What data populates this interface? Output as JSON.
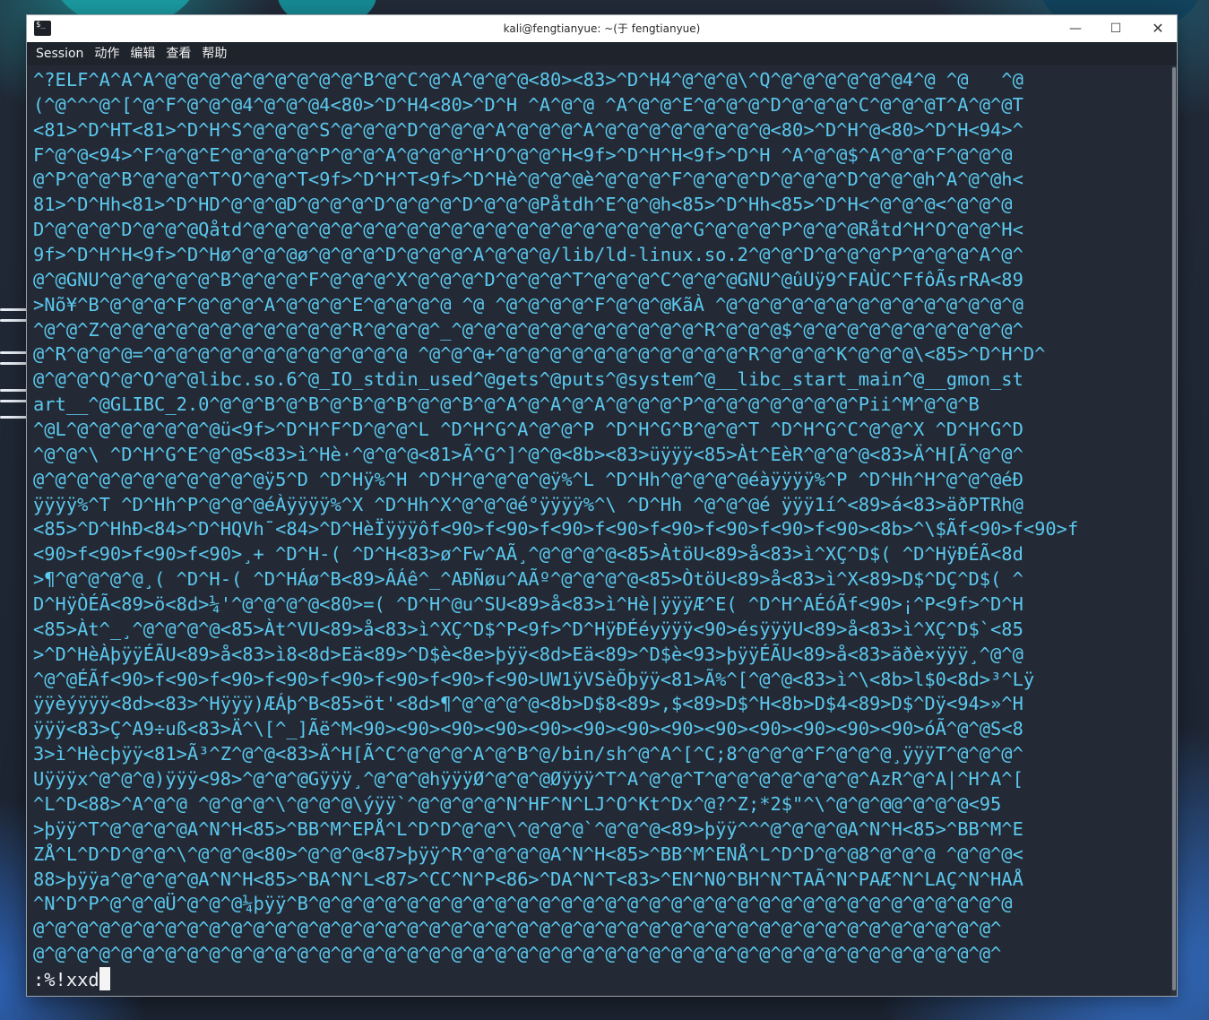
{
  "window": {
    "title": "kali@fengtianyue: ~(于 fengtianyue)",
    "app_icon_glyph": "$_",
    "controls": {
      "minimize": "—",
      "maximize": "☐",
      "close": "✕"
    }
  },
  "menu": [
    "Session",
    "动作",
    "编辑",
    "查看",
    "帮助"
  ],
  "terminal": {
    "lines": [
      "^?ELF^A^A^A^@^@^@^@^@^@^@^@^@^B^@^C^@^A^@^@^@<80><83>^D^H4^@^@^@\\^Q^@^@^@^@^@^@4^@ ^@   ^@",
      "(^@^^^@^[^@^F^@^@^@4^@^@^@4<80>^D^H4<80>^D^H ^A^@^@ ^A^@^@^E^@^@^@^D^@^@^@^C^@^@^@T^A^@^@T",
      "<81>^D^HT<81>^D^H^S^@^@^@^S^@^@^@^D^@^@^@^A^@^@^@^A^@^@^@^@^@^@^@^@<80>^D^H^@<80>^D^H<94>^",
      "F^@^@<94>^F^@^@^E^@^@^@^@^P^@^@^A^@^@^@^H^O^@^@^H<9f>^D^H^H<9f>^D^H ^A^@^@$^A^@^@^F^@^@^@",
      "@^P^@^@^B^@^@^@^T^O^@^@^T<9f>^D^H^T<9f>^D^Hè^@^@^@è^@^@^@^F^@^@^@^D^@^@^@^D^@^@^@h^A^@^@h<",
      "81>^D^Hh<81>^D^HD^@^@^@D^@^@^@^D^@^@^@^D^@^@^@Påtdh^E^@^@h<85>^D^Hh<85>^D^H<^@^@^@<^@^@^@",
      "D^@^@^@^D^@^@^@Qåtd^@^@^@^@^@^@^@^@^@^@^@^@^@^@^@^@^@^@^@^@^G^@^@^@^P^@^@^@Råtd^H^O^@^@^H<",
      "9f>^D^H^H<9f>^D^Hø^@^@^@ø^@^@^@^D^@^@^@^A^@^@^@/lib/ld-linux.so.2^@^@^D^@^@^@^P^@^@^@^A^@^",
      "@^@GNU^@^@^@^@^@^B^@^@^@^F^@^@^@^X^@^@^@^D^@^@^@^T^@^@^@^C^@^@^@GNU^@ûUÿ9^FAÙC^FfôÃsrRA<89",
      ">Nõ¥^B^@^@^@^F^@^@^@^A^@^@^@^E^@^@^@^@ ^@ ^@^@^@^@^F^@^@^@KãÀ ^@^@^@^@^@^@^@^@^@^@^@^@^@^@",
      "^@^@^Z^@^@^@^@^@^@^@^@^@^@^@^R^@^@^@^_^@^@^@^@^@^@^@^@^@^@^@^R^@^@^@$^@^@^@^@^@^@^@^@^@^@^",
      "@^R^@^@^@=^@^@^@^@^@^@^@^@^@^@^@^@ ^@^@^@+^@^@^@^@^@^@^@^@^@^@^@^R^@^@^@^K^@^@^@\\<85>^D^H^D^",
      "@^@^@^Q^@^O^@^@libc.so.6^@_IO_stdin_used^@gets^@puts^@system^@__libc_start_main^@__gmon_st",
      "art__^@GLIBC_2.0^@^@^B^@^B^@^B^@^B^@^@^B^@^A^@^A^@^A^@^@^@^P^@^@^@^@^@^@^@^Pii^M^@^@^B",
      "^@L^@^@^@^@^@^@^@ü<9f>^D^H^F^D^@^@^L ^D^H^G^A^@^@^P ^D^H^G^B^@^@^T ^D^H^G^C^@^@^X ^D^H^G^D",
      "^@^@^\\ ^D^H^G^E^@^@S<83>ì^Hè·^@^@^@<81>Ã^G^]^@^@<8b><83>üÿÿÿ<85>Àt^EèR^@^@^@<83>Ä^H[Ã^@^@^",
      "@^@^@^@^@^@^@^@^@^@^@ÿ5^D ^D^Hÿ%^H ^D^H^@^@^@^@ÿ%^L ^D^Hh^@^@^@^@éàÿÿÿÿ%^P ^D^Hh^H^@^@^@éÐ",
      "ÿÿÿÿ%^T ^D^Hh^P^@^@^@éÀÿÿÿÿ%^X ^D^Hh^X^@^@^@é°ÿÿÿÿ%^\\ ^D^Hh ^@^@^@é ÿÿÿ1í^<89>á<83>äðPTRh@",
      "<85>^D^HhÐ<84>^D^HQVh¯<84>^D^HèÏÿÿÿôf<90>f<90>f<90>f<90>f<90>f<90>f<90>f<90><8b>^\\$Ãf<90>f<90>f",
      "<90>f<90>f<90>f<90>¸+ ^D^H-( ^D^H<83>ø^Fw^AÃ¸^@^@^@^@<85>ÀtöU<89>å<83>ì^XÇ^D$( ^D^HÿÐÉÃ<8d",
      ">¶^@^@^@^@¸( ^D^H-( ^D^HÁø^B<89>ÂÁê^_^AÐÑøu^AÃº^@^@^@^@<85>ÒtöU<89>å<83>ì^X<89>D$^DÇ^D$( ^",
      "D^HÿÒÉÃ<89>ö<8d>¼'^@^@^@^@<80>=( ^D^H^@u^SU<89>å<83>ì^Hè|ÿÿÿÆ^E( ^D^H^AÉóÃf<90>¡^P<9f>^D^H",
      "<85>Àt^_¸^@^@^@^@<85>Àt^VU<89>å<83>ì^XÇ^D$^P<9f>^D^HÿÐÉéyÿÿÿ<90>ésÿÿÿU<89>å<83>ì^XÇ^D$`<85",
      ">^D^HèÀþÿÿÉÃU<89>å<83>ì8<8d>Eä<89>^D$è<8e>þÿÿ<8d>Eä<89>^D$è<93>þÿÿÉÃU<89>å<83>äðè×ÿÿÿ¸^@^@",
      "^@^@ÉÃf<90>f<90>f<90>f<90>f<90>f<90>f<90>f<90>UW1ÿVSèÕþÿÿ<81>Ã%^[^@^@<83>ì^\\<8b>l$0<8d>³^Lÿ",
      "ÿÿèýÿÿÿ<8d><83>^Hÿÿÿ)ÆÁþ^B<85>öt'<8d>¶^@^@^@^@<8b>D$8<89>,$<89>D$^H<8b>D$4<89>D$^Dÿ<94>»^H",
      "ÿÿÿ<83>Ç^A9÷uß<83>Ä^\\[^_]Ãë^M<90><90><90><90><90><90><90><90><90><90><90><90><90>óÃ^@^@S<8",
      "3>ì^Hècþÿÿ<81>Ã³^Z^@^@<83>Ä^H[Ã^C^@^@^@^A^@^B^@/bin/sh^@^A^[^C;8^@^@^@^F^@^@^@¸ÿÿÿT^@^@^@^",
      "Uÿÿÿx^@^@^@)ÿÿÿ<98>^@^@^@Gÿÿÿ¸^@^@^@hÿÿÿØ^@^@^@Øÿÿÿ^T^A^@^@^T^@^@^@^@^@^@^@^AzR^@^A|^H^A^[",
      "^L^D<88>^A^@^@ ^@^@^@^\\^@^@^@\\ýÿÿ`^@^@^@^@^N^HF^N^LJ^O^Kt^Dx^@?^Z;*2$\"^\\^@^@^@@^@^@^@<95",
      ">þÿÿ^T^@^@^@^@A^N^H<85>^BB^M^EPÅ^L^D^D^@^@^\\^@^@^@`^@^@^@<89>þÿÿ^^^@^@^@^@A^N^H<85>^BB^M^E",
      "ZÅ^L^D^D^@^@^\\^@^@^@<80>^@^@^@<87>þÿÿ^R^@^@^@^@A^N^H<85>^BB^M^ENÅ^L^D^D^@^@8^@^@^@ ^@^@^@<",
      "88>þÿÿa^@^@^@^@A^N^H<85>^BA^N^L<87>^CC^N^P<86>^DA^N^T<83>^EN^N0^BH^N^TAÃ^N^PAÆ^N^LAÇ^N^HAÅ",
      "^N^D^P^@^@^@Ü^@^@^@¼þÿÿ^B^@^@^@^@^@^@^@^@^@^@^@^@^@^@^@^@^@^@^@^@^@^@^@^@^@^@^@^@^@^@^@^@",
      "@^@^@^@^@^@^@^@^@^@^@^@^@^@^@^@^@^@^@^@^@^@^@^@^@^@^@^@^@^@^@^@^@^@^@^@^@^@^@^@^@^@^@^@^",
      "@^@^@^@^@^@^@^@^@^@^@^@^@^@^@^@^@^@^@^@^@^@^@^@^@^@^@^@^@^@^@^@^@^@^@^@^@^@^@^@^@^@^@^@^"
    ],
    "command": ":%!xxd"
  }
}
